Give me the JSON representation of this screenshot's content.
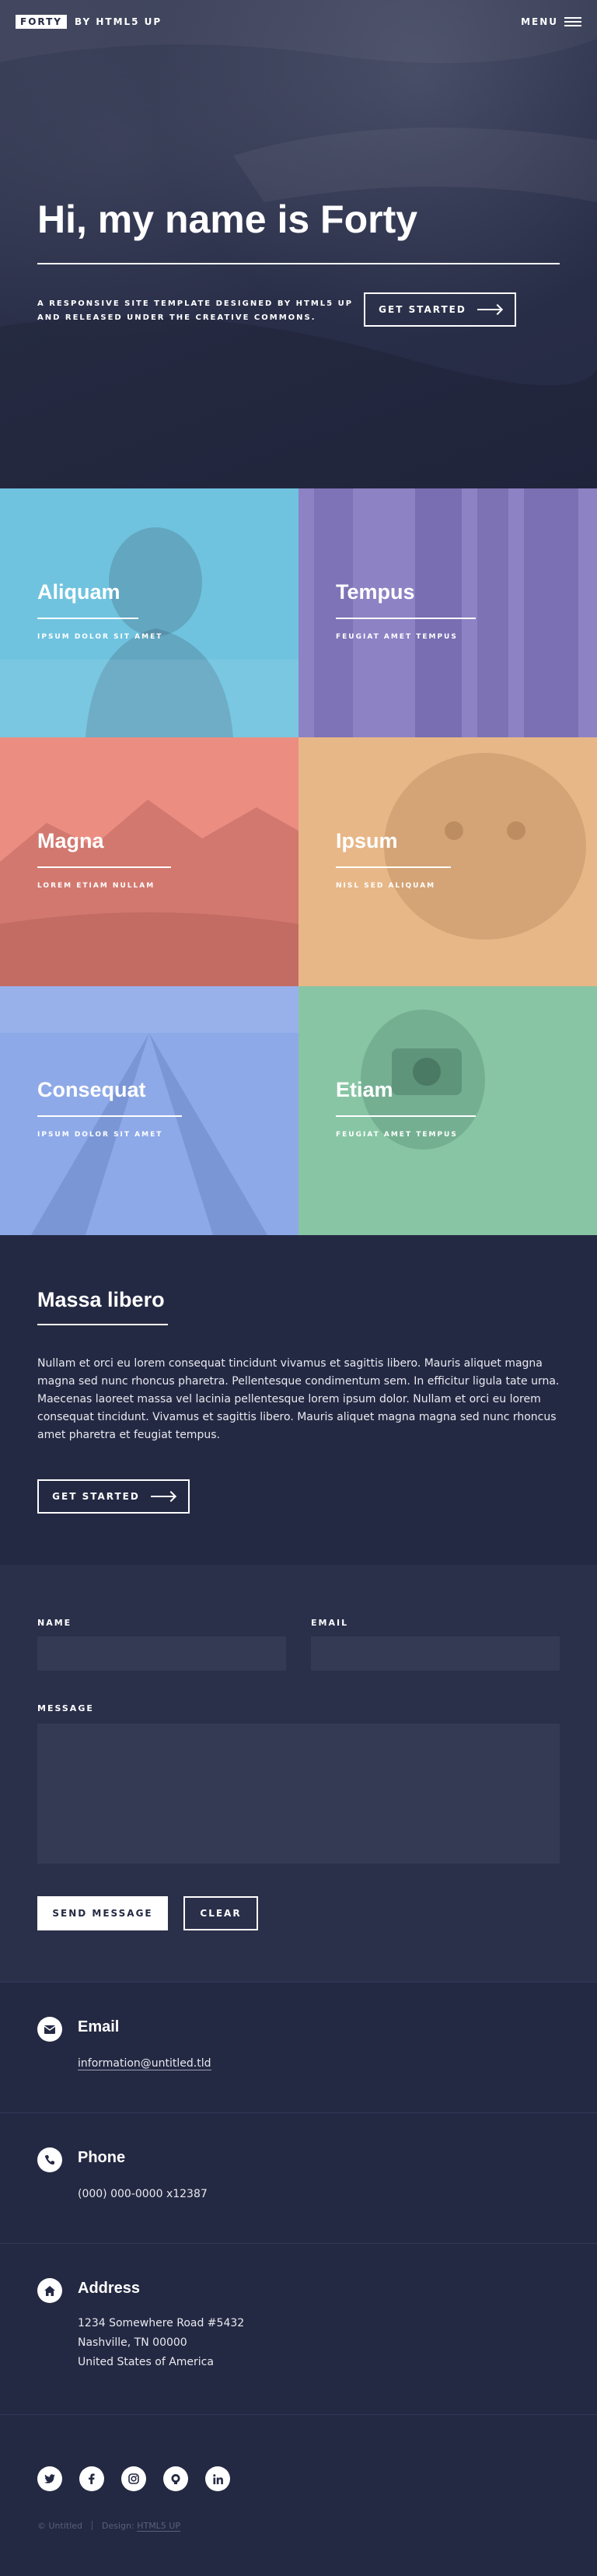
{
  "header": {
    "logo_box": "FORTY",
    "logo_text": "BY HTML5 UP",
    "menu_label": "MENU"
  },
  "banner": {
    "title": "Hi, my name is Forty",
    "subtitle_line1": "A RESPONSIVE SITE TEMPLATE DESIGNED BY HTML5 UP",
    "subtitle_line2": "AND RELEASED UNDER THE CREATIVE COMMONS.",
    "cta_label": "GET STARTED"
  },
  "tiles": [
    {
      "title": "Aliquam",
      "subtitle": "IPSUM DOLOR SIT AMET",
      "color": "#6fc3df"
    },
    {
      "title": "Tempus",
      "subtitle": "FEUGIAT AMET TEMPUS",
      "color": "#8d82c4"
    },
    {
      "title": "Magna",
      "subtitle": "LOREM ETIAM NULLAM",
      "color": "#ec8d81"
    },
    {
      "title": "Ipsum",
      "subtitle": "NISL SED ALIQUAM",
      "color": "#e7b788"
    },
    {
      "title": "Consequat",
      "subtitle": "IPSUM DOLOR SIT AMET",
      "color": "#8ea9e8"
    },
    {
      "title": "Etiam",
      "subtitle": "FEUGIAT AMET TEMPUS",
      "color": "#87c5a4"
    }
  ],
  "section": {
    "title": "Massa libero",
    "body": "Nullam et orci eu lorem consequat tincidunt vivamus et sagittis libero. Mauris aliquet magna magna sed nunc rhoncus pharetra. Pellentesque condimentum sem. In efficitur ligula tate urna. Maecenas laoreet massa vel lacinia pellentesque lorem ipsum dolor. Nullam et orci eu lorem consequat tincidunt. Vivamus et sagittis libero. Mauris aliquet magna magna sed nunc rhoncus amet pharetra et feugiat tempus.",
    "cta_label": "GET STARTED"
  },
  "form": {
    "name_label": "NAME",
    "email_label": "EMAIL",
    "message_label": "MESSAGE",
    "name_value": "",
    "email_value": "",
    "message_value": "",
    "send_label": "SEND MESSAGE",
    "clear_label": "CLEAR"
  },
  "contact": {
    "email_heading": "Email",
    "email_value": "information@untitled.tld",
    "phone_heading": "Phone",
    "phone_value": "(000) 000-0000 x12387",
    "address_heading": "Address",
    "address_line1": "1234 Somewhere Road #5432",
    "address_line2": "Nashville, TN 00000",
    "address_line3": "United States of America"
  },
  "footer": {
    "social_icons": [
      "twitter-icon",
      "facebook-icon",
      "instagram-icon",
      "github-icon",
      "linkedin-icon"
    ],
    "copyright": "© Untitled",
    "design_label": "Design:",
    "design_link": "HTML5 UP"
  },
  "colors": {
    "background": "#242943",
    "form_background": "#2a2f4a",
    "field_background": "#353a54",
    "accent": "#ffffff"
  }
}
